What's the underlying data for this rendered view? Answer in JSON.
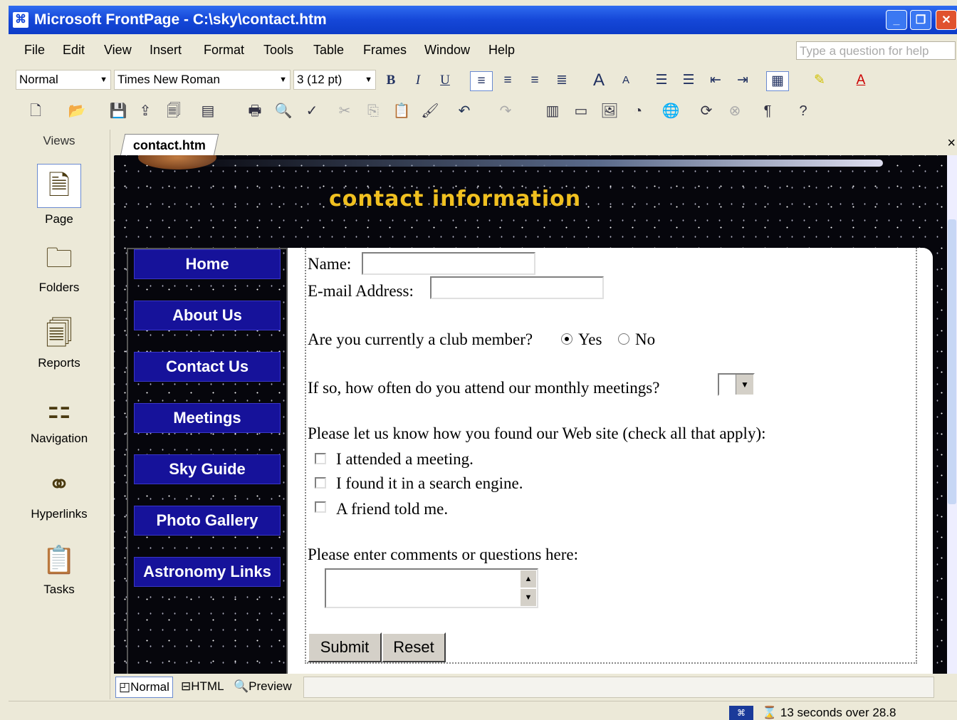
{
  "window": {
    "title": "Microsoft FrontPage - C:\\sky\\contact.htm",
    "buttons": [
      "_",
      "❐",
      "✕"
    ]
  },
  "menu": [
    "File",
    "Edit",
    "View",
    "Insert",
    "Format",
    "Tools",
    "Table",
    "Frames",
    "Window",
    "Help"
  ],
  "help_placeholder": "Type a question for help",
  "format_toolbar": {
    "style": "Normal",
    "font": "Times New Roman",
    "size": "3  (12 pt)"
  },
  "views": {
    "header": "Views",
    "items": [
      {
        "label": "Page",
        "icon": "page-icon"
      },
      {
        "label": "Folders",
        "icon": "folder-icon"
      },
      {
        "label": "Reports",
        "icon": "reports-icon"
      },
      {
        "label": "Navigation",
        "icon": "navigation-icon"
      },
      {
        "label": "Hyperlinks",
        "icon": "hyperlinks-icon"
      },
      {
        "label": "Tasks",
        "icon": "tasks-icon"
      }
    ]
  },
  "document": {
    "tab": "contact.htm",
    "close": "×"
  },
  "site": {
    "heading": "contact information",
    "nav": [
      "Home",
      "About Us",
      "Contact Us",
      "Meetings",
      "Sky Guide",
      "Photo Gallery",
      "Astronomy Links"
    ]
  },
  "form": {
    "name_label": "Name:",
    "email_label": "E-mail Address:",
    "member_question": "Are you currently a club member?",
    "member_yes": "Yes",
    "member_no": "No",
    "frequency_question": "If so, how often do you attend our monthly meetings?",
    "found_question": "Please let us know how you found our Web site (check all that apply):",
    "found_options": [
      "I attended a meeting.",
      "I found it in a search engine.",
      "A friend told me."
    ],
    "comments_label": "Please enter comments or questions here:",
    "submit": "Submit",
    "reset": "Reset"
  },
  "view_tabs": [
    "Normal",
    "HTML",
    "Preview"
  ],
  "status": {
    "text": "13 seconds over 28.8"
  },
  "colors": {
    "heading": "#f0c020",
    "nav_button": "#16129a",
    "title_bar": "#1547d8"
  }
}
